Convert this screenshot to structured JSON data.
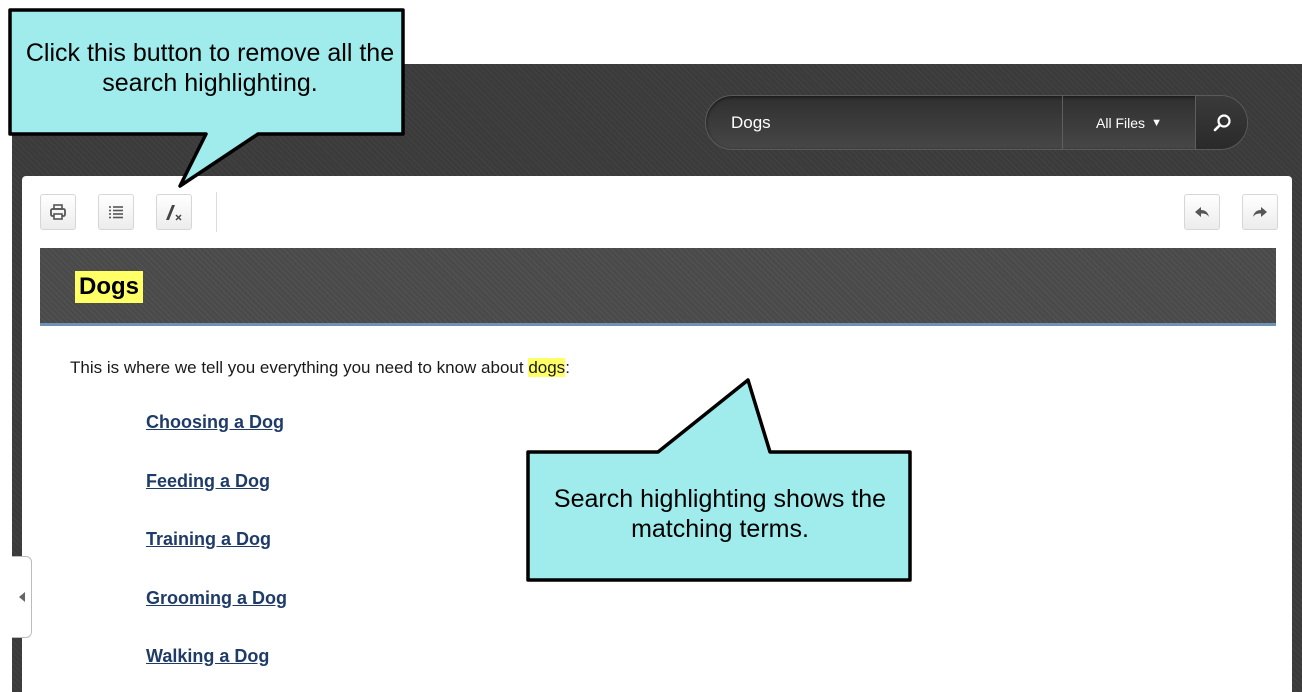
{
  "search": {
    "query": "Dogs",
    "filter_label": "All Files",
    "filter_arrow": "▼",
    "icon": "search-icon"
  },
  "toolbar": {
    "print_icon": "print-icon",
    "toc_icon": "list-icon",
    "remove_highlight_icon": "remove-highlight-icon",
    "back_icon": "back-arrow-icon",
    "forward_icon": "forward-arrow-icon"
  },
  "topic": {
    "title": "Dogs",
    "intro_before": "This is where we tell you everything you need to know about ",
    "intro_highlight": "dogs",
    "intro_after": ":",
    "links": [
      "Choosing a Dog",
      "Feeding a Dog",
      "Training a Dog",
      "Grooming a Dog",
      "Walking a Dog"
    ]
  },
  "callouts": {
    "top": "Click this button to remove all the search highlighting.",
    "middle": "Search highlighting shows the matching terms."
  },
  "colors": {
    "highlight": "#ffff66",
    "callout_fill": "#a0ecec",
    "link": "#1f3b68"
  }
}
